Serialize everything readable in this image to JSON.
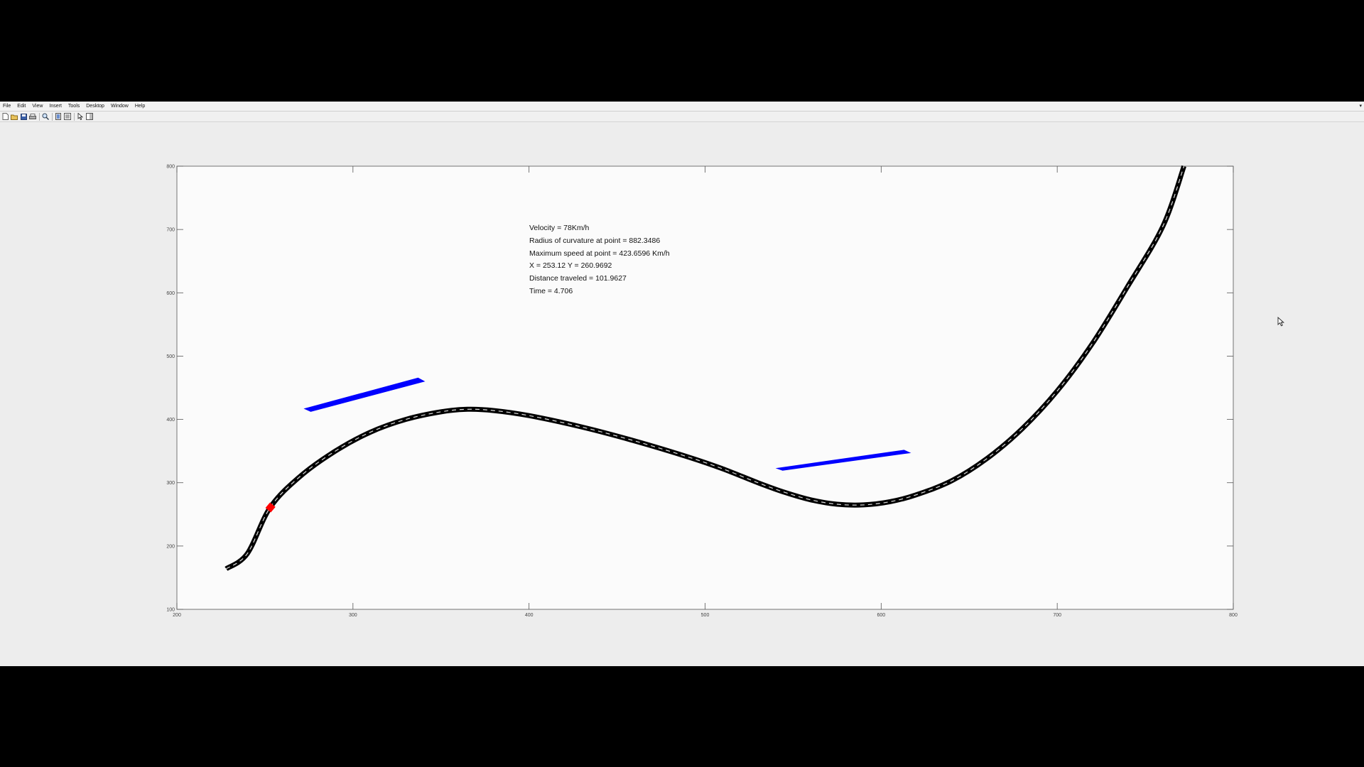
{
  "menubar": {
    "items": [
      "File",
      "Edit",
      "View",
      "Insert",
      "Tools",
      "Desktop",
      "Window",
      "Help"
    ],
    "arrow_icon": "chevron-down-icon"
  },
  "toolbar": {
    "buttons": [
      "new-figure-icon",
      "open-file-icon",
      "save-icon",
      "print-icon",
      "zoom-icon",
      "insert-colorbar-icon",
      "insert-legend-icon",
      "pointer-icon",
      "plot-tools-icon"
    ]
  },
  "info": {
    "velocity": "Velocity = 78Km/h",
    "radius": "Radius of curvature at point = 882.3486",
    "max_speed": "Maximum speed at point = 423.6596 Km/h",
    "position": "X = 253.12 Y = 260.9692",
    "distance": "Distance traveled = 101.9627",
    "time": "Time = 4.706"
  },
  "chart_data": {
    "type": "line",
    "xlim": [
      200,
      800
    ],
    "ylim": [
      100,
      800
    ],
    "x_ticks": [
      "200",
      "300",
      "400",
      "500",
      "600",
      "700",
      "800"
    ],
    "y_ticks": [
      "100",
      "200",
      "300",
      "400",
      "500",
      "600",
      "700",
      "800"
    ],
    "grid": false,
    "road": {
      "color": "#000000",
      "centerline_color": "#dddddd",
      "points": [
        [
          228,
          164
        ],
        [
          240,
          188
        ],
        [
          253,
          261
        ],
        [
          270,
          310
        ],
        [
          290,
          350
        ],
        [
          310,
          380
        ],
        [
          330,
          400
        ],
        [
          350,
          412
        ],
        [
          365,
          416
        ],
        [
          380,
          414
        ],
        [
          400,
          406
        ],
        [
          430,
          388
        ],
        [
          460,
          366
        ],
        [
          490,
          341
        ],
        [
          510,
          322
        ],
        [
          530,
          300
        ],
        [
          545,
          285
        ],
        [
          560,
          273
        ],
        [
          575,
          266
        ],
        [
          590,
          265
        ],
        [
          605,
          270
        ],
        [
          620,
          281
        ],
        [
          640,
          303
        ],
        [
          660,
          338
        ],
        [
          680,
          385
        ],
        [
          700,
          445
        ],
        [
          720,
          520
        ],
        [
          740,
          610
        ],
        [
          760,
          705
        ],
        [
          772,
          800
        ]
      ]
    },
    "vehicle": {
      "x": 253.12,
      "y": 260.9692,
      "color": "#ff0000"
    },
    "obstacles": [
      {
        "color": "#0000ff",
        "corners": [
          [
            272,
            417
          ],
          [
            337,
            466
          ],
          [
            341,
            460
          ],
          [
            276,
            412
          ]
        ]
      },
      {
        "color": "#0000ff",
        "corners": [
          [
            540,
            323
          ],
          [
            613,
            352
          ],
          [
            617,
            347
          ],
          [
            544,
            319
          ]
        ]
      }
    ]
  }
}
